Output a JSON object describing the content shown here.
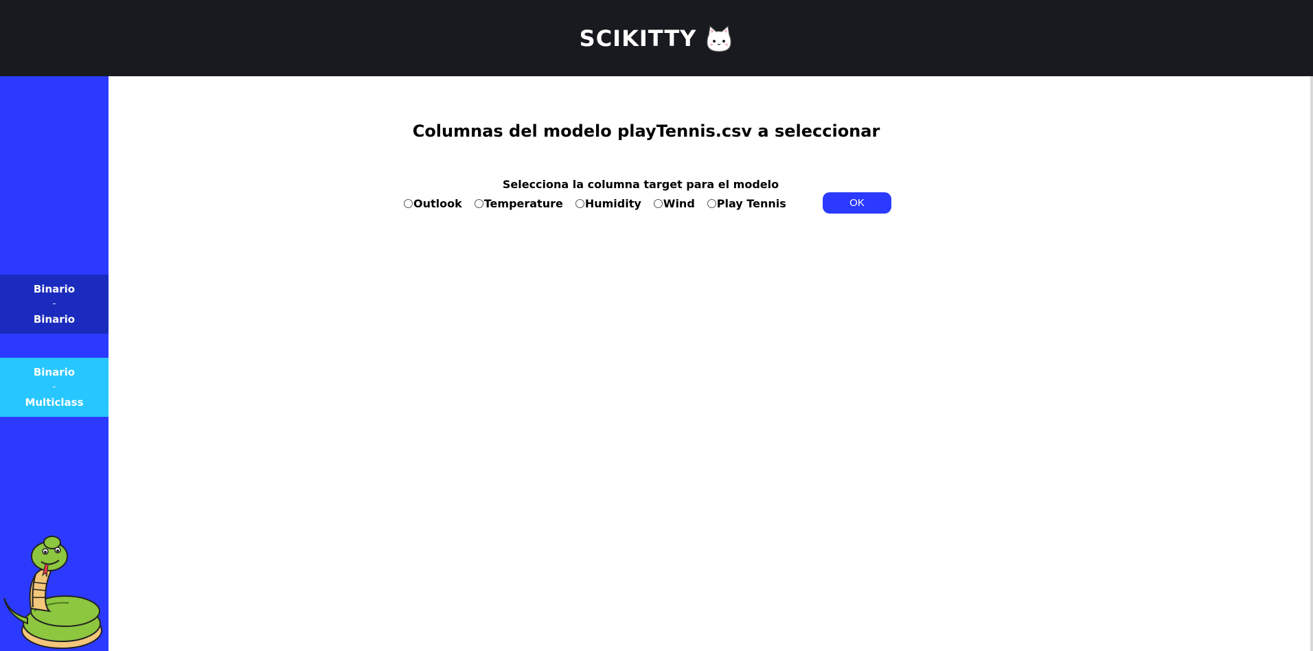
{
  "header": {
    "title": "SCIKITTY",
    "logo_icon": "cat-face-icon"
  },
  "sidebar": {
    "items": [
      {
        "line1": "Binario",
        "sep": "-",
        "line2": "Binario",
        "color": "#1b2bbd"
      },
      {
        "line1": "Binario",
        "sep": "-",
        "line2": "Multiclass",
        "color": "#27c6ff"
      }
    ],
    "mascot_icon": "snake-mascot",
    "background": "#2b3afe"
  },
  "main": {
    "title": "Columnas del modelo playTennis.csv a seleccionar",
    "prompt": "Selecciona la columna target para el modelo",
    "options": [
      "Outlook",
      "Temperature",
      "Humidity",
      "Wind",
      "Play Tennis"
    ],
    "ok_label": "OK"
  },
  "colors": {
    "topbar": "#181a1f",
    "accent": "#2b3afe"
  }
}
